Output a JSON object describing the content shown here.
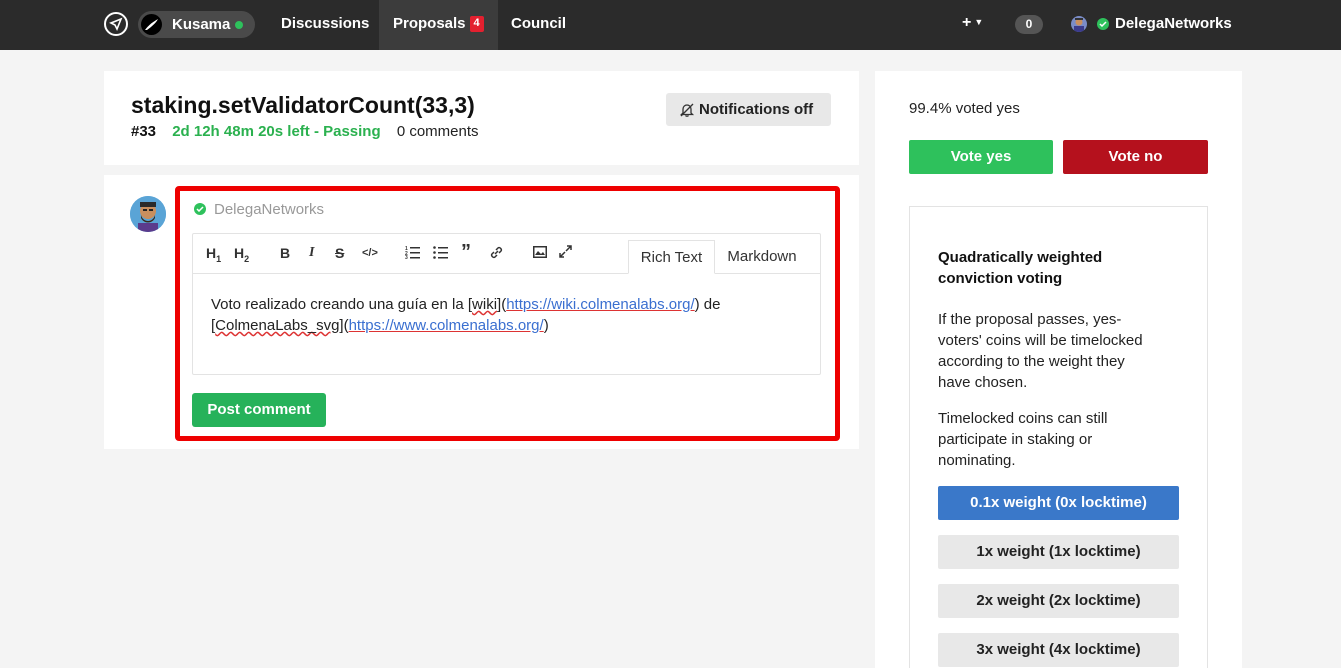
{
  "topbar": {
    "chain_name": "Kusama",
    "nav": {
      "discussions": "Discussions",
      "proposals": "Proposals",
      "proposals_count": "4",
      "council": "Council"
    },
    "new_label": "+",
    "notifications_count": "0",
    "user_name": "DelegaNetworks"
  },
  "proposal": {
    "title": "staking.setValidatorCount(33,3)",
    "id": "#33",
    "time_left": "2d 12h 48m 20s left - Passing",
    "comments": "0 comments",
    "notifications_button": "Notifications off"
  },
  "comment_form": {
    "author": "DelegaNetworks",
    "tabs": {
      "rich": "Rich Text",
      "markdown": "Markdown"
    },
    "text": {
      "t1": "Voto realizado creando una guía en la [",
      "t2": "wiki",
      "t3": "](",
      "t4": "https://wiki.colmenalabs.org/",
      "t5": ") de",
      "t6": "[",
      "t7": "ColmenaLabs_svg",
      "t8": "](",
      "t9": "https://www.colmenalabs.org/",
      "t10": ")"
    },
    "post_button": "Post comment"
  },
  "sidebar": {
    "voted_yes": "99.4% voted yes",
    "vote_yes": "Vote yes",
    "vote_no": "Vote no",
    "conviction": {
      "title": "Quadratically weighted conviction voting",
      "p1": "If the proposal passes, yes-voters' coins will be timelocked according to the weight they have chosen.",
      "p2": "Timelocked coins can still participate in staking or nominating.",
      "options": [
        {
          "label": "0.1x weight (0x locktime)",
          "selected": true
        },
        {
          "label": "1x weight (1x locktime)",
          "selected": false
        },
        {
          "label": "2x weight (2x locktime)",
          "selected": false
        },
        {
          "label": "3x weight (4x locktime)",
          "selected": false
        }
      ]
    }
  },
  "colors": {
    "green": "#2ec15c",
    "red": "#b5111d",
    "blue": "#3a78c9",
    "highlight_frame": "#ee0000"
  },
  "icons": [
    "compass-icon",
    "kusama-bird-icon",
    "bell-off-icon",
    "check-icon",
    "heading1-icon",
    "heading2-icon",
    "bold-icon",
    "italic-icon",
    "strike-icon",
    "code-icon",
    "ordered-list-icon",
    "bullet-list-icon",
    "quote-icon",
    "link-icon",
    "image-icon",
    "expand-icon"
  ]
}
